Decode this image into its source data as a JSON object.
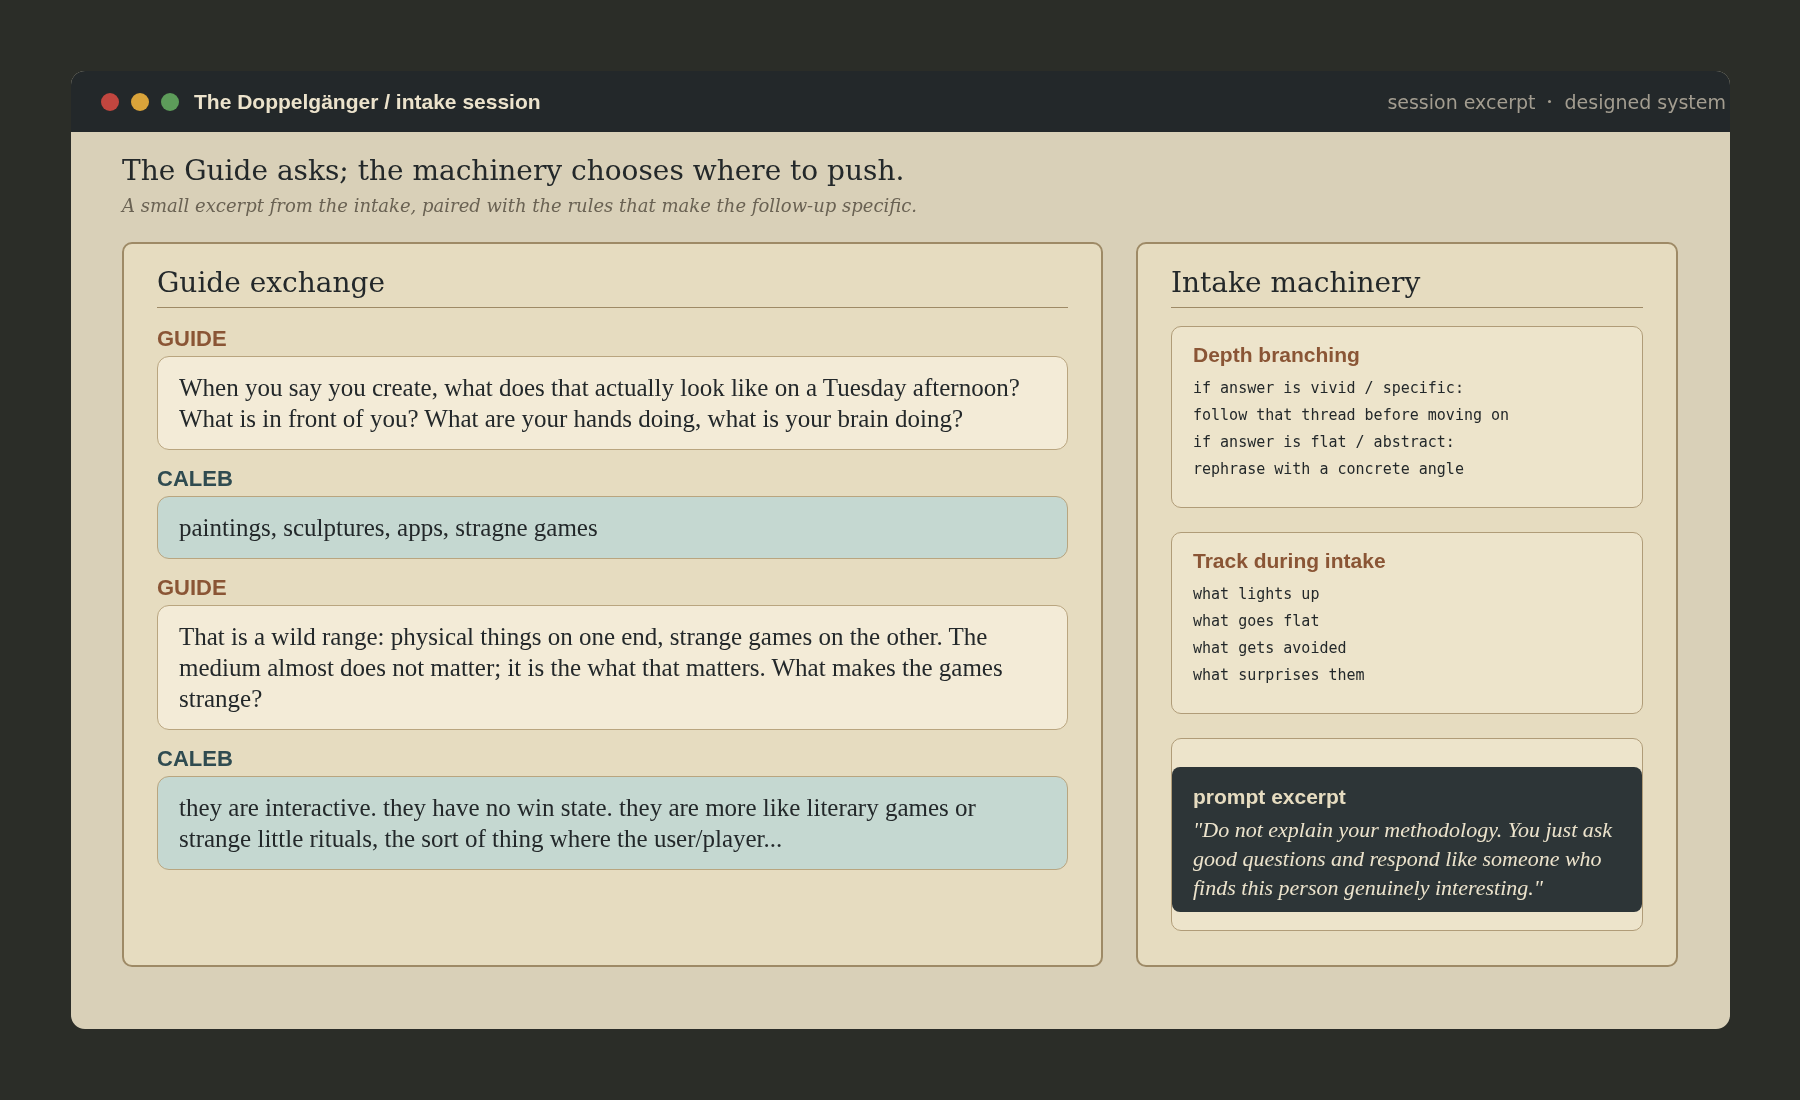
{
  "window": {
    "title": "The Doppelgänger / intake session",
    "meta": [
      "session excerpt",
      "designed system"
    ]
  },
  "header": {
    "title": "The Guide asks; the machinery chooses where to push.",
    "subtitle": "A small excerpt from the intake, paired with the rules that make the follow-up specific."
  },
  "exchange": {
    "title": "Guide exchange",
    "messages": [
      {
        "kind": "guide",
        "speaker": "GUIDE",
        "text": "When you say you create, what does that actually look like on a Tuesday afternoon? What is in front of you? What are your hands doing, what is your brain doing?"
      },
      {
        "kind": "user",
        "speaker": "CALEB",
        "text": "paintings, sculptures, apps, stragne games"
      },
      {
        "kind": "guide",
        "speaker": "GUIDE",
        "text": "That is a wild range: physical things on one end, strange games on the other. The medium almost does not matter; it is the what that matters. What makes the games strange?"
      },
      {
        "kind": "user",
        "speaker": "CALEB",
        "text": "they are interactive. they have no win state. they are more like literary games or strange little rituals, the sort of thing where the user/player..."
      }
    ]
  },
  "machinery": {
    "title": "Intake machinery",
    "cards": [
      {
        "title": "Depth branching",
        "lines": [
          "if answer is vivid / specific:",
          "follow that thread before moving on",
          "if answer is flat / abstract:",
          "rephrase with a concrete angle"
        ]
      },
      {
        "title": "Track during intake",
        "lines": [
          "what lights up",
          "what goes flat",
          "what gets avoided",
          "what surprises them"
        ]
      }
    ],
    "excerpt": {
      "title": "prompt excerpt",
      "quote": "\"Do not explain your methodology. You just ask good questions and respond like someone who finds this person genuinely interesting.\""
    }
  }
}
